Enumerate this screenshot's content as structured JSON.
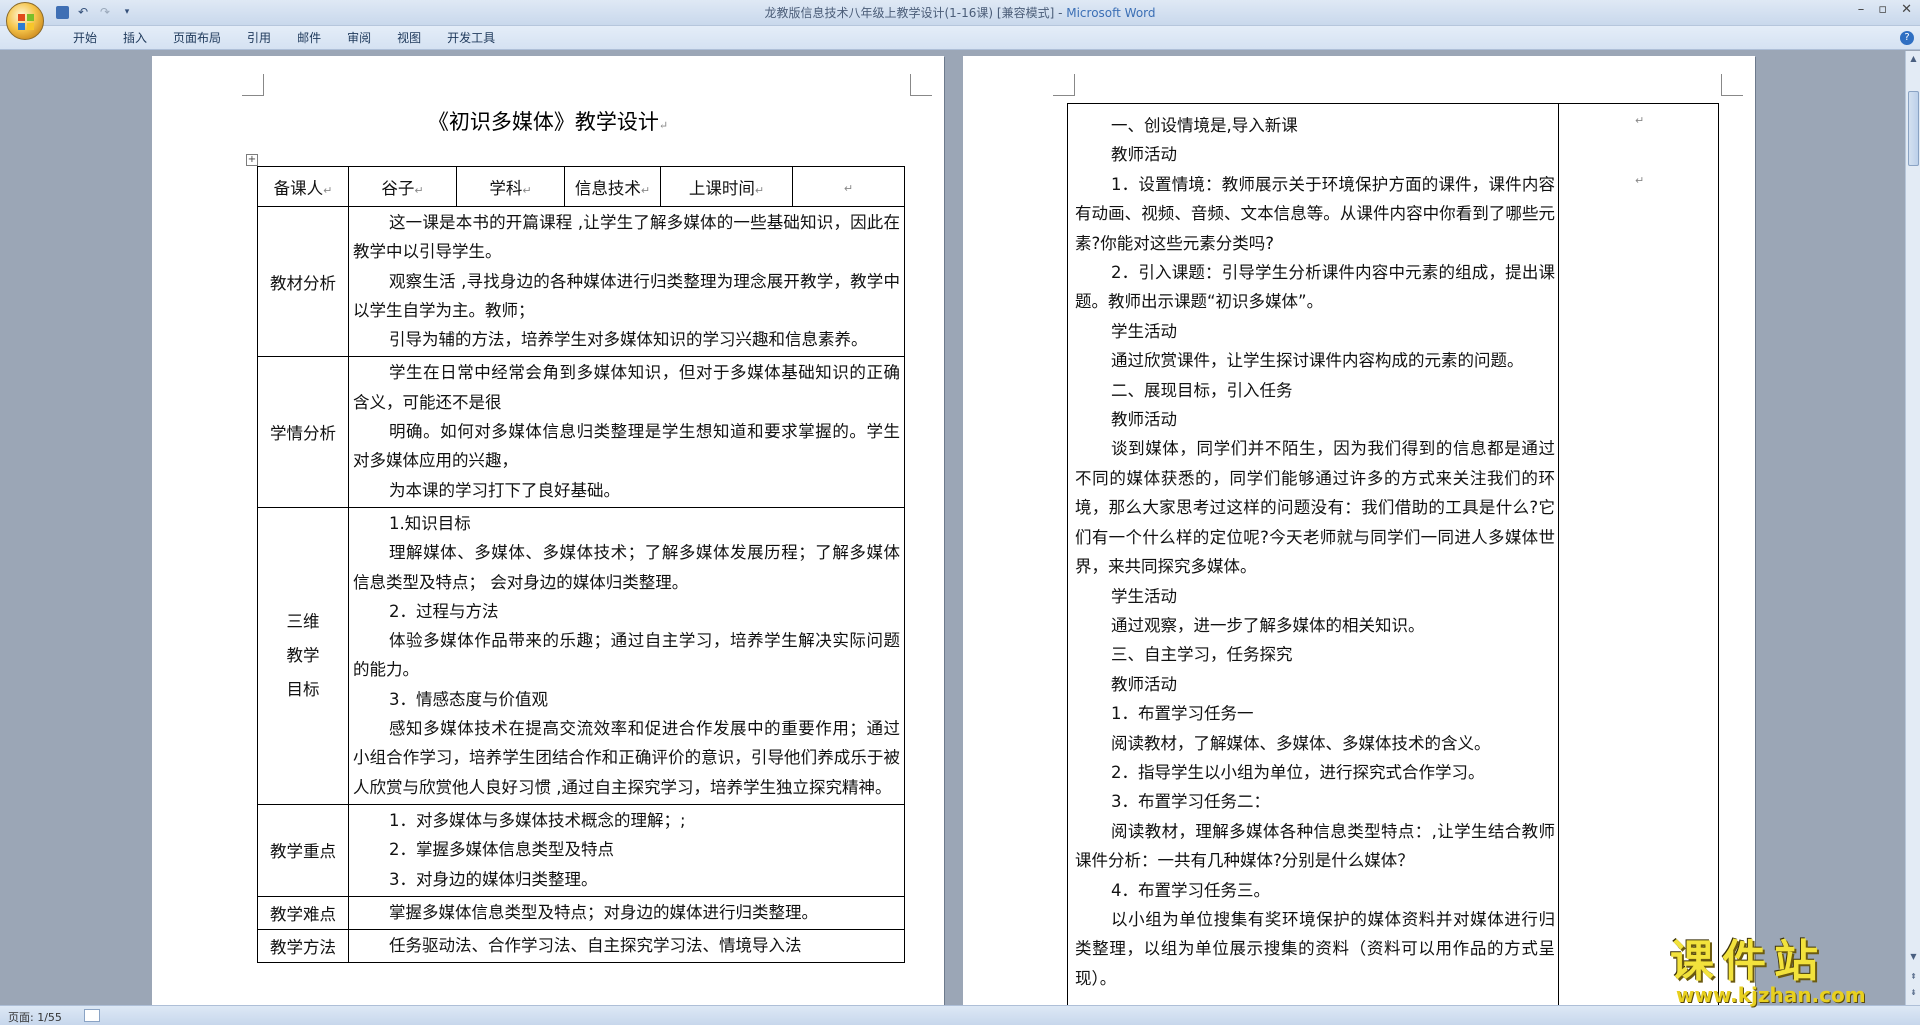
{
  "window": {
    "title": "龙教版信息技术八年级上教学设计(1-16课) [兼容模式] - ",
    "app_name": "Microsoft Word"
  },
  "ribbon": {
    "tabs": [
      "开始",
      "插入",
      "页面布局",
      "引用",
      "邮件",
      "审阅",
      "视图",
      "开发工具"
    ]
  },
  "status": {
    "page": "页面: 1/55"
  },
  "page1": {
    "title": "《初识多媒体》教学设计",
    "header": {
      "preparer_label": "备课人",
      "preparer": "谷子",
      "subject_label": "学科",
      "subject": "信息技术",
      "time_label": "上课时间",
      "time": ""
    },
    "rows": [
      {
        "label": "教材分析",
        "paras": [
          "这一课是本书的开篇课程 ,让学生了解多媒体的一些基础知识，因此在教学中以引导学生。",
          "观察生活 ,寻找身边的各种媒体进行归类整理为理念展开教学，教学中以学生自学为主。教师；",
          "引导为辅的方法，培养学生对多媒体知识的学习兴趣和信息素养。"
        ]
      },
      {
        "label": "学情分析",
        "paras": [
          "学生在日常中经常会角到多媒体知识，但对于多媒体基础知识的正确含义，可能还不是很",
          "明确。如何对多媒体信息归类整理是学生想知道和要求掌握的。学生对多媒体应用的兴趣，",
          "为本课的学习打下了良好基础。"
        ]
      },
      {
        "label_lines": [
          "三维",
          "教学",
          "目标"
        ],
        "paras": [
          "1.知识目标",
          "理解媒体、多媒体、多媒体技术；了解多媒体发展历程；了解多媒体信息类型及特点； 会对身边的媒体归类整理。",
          " 2．过程与方法",
          "体验多媒体作品带来的乐趣；通过自主学习，培养学生解决实际问题的能力。",
          "3．情感态度与价值观",
          "感知多媒体技术在提高交流效率和促进合作发展中的重要作用；通过小组合作学习，培养学生团结合作和正确评价的意识，引导他们养成乐于被人欣赏与欣赏他人良好习惯 ,通过自主探究学习，培养学生独立探究精神。"
        ]
      },
      {
        "label": "教学重点",
        "paras": [
          "1．对多媒体与多媒体技术概念的理解；;",
          "2．掌握多媒体信息类型及特点",
          "3．对身边的媒体归类整理。"
        ]
      },
      {
        "label": "教学难点",
        "paras": [
          "掌握多媒体信息类型及特点；对身边的媒体进行归类整理。"
        ]
      },
      {
        "label": "教学方法",
        "paras": [
          "任务驱动法、合作学习法、自主探究学习法、情境导入法"
        ]
      }
    ]
  },
  "page2": {
    "paras": [
      "一、创设情境是,导入新课",
      "教师活动",
      "1．设置情境：教师展示关于环境保护方面的课件，课件内容有动画、视频、音频、文本信息等。从课件内容中你看到了哪些元素?你能对这些元素分类吗?",
      "2．引入课题：引导学生分析课件内容中元素的组成，提出课题。教师出示课题“初识多媒体”。",
      "学生活动 ",
      "通过欣赏课件，让学生探讨课件内容构成的元素的问题。",
      "二、展现目标，引入任务",
      "教师活动",
      "谈到媒体，同学们并不陌生，因为我们得到的信息都是通过不同的媒体获悉的，同学们能够通过许多的方式来关注我们的环境，那么大家思考过这样的问题没有：我们借助的工具是什么?它们有一个什么样的定位呢?今天老师就与同学们一同进人多媒体世界，来共同探究多媒体。",
      "学生活动",
      "通过观察，进一步了解多媒体的相关知识。",
      "三、自主学习，任务探究",
      "教师活动 ",
      "1．布置学习任务一",
      "阅读教材，了解媒体、多媒体、多媒体技术的含义。",
      "2．指导学生以小组为单位，进行探究式合作学习。",
      "3．布置学习任务二：",
      "阅读教材，理解多媒体各种信息类型特点：,让学生结合教师课件分析：一共有几种媒体?分别是什么媒体？",
      "4．布置学习任务三。",
      " 以小组为单位搜集有奖环境保护的媒体资料并对媒体进行归类整理，以组为单位展示搜集的资料（资料可以用作品的方式呈现）。"
    ]
  },
  "watermark": {
    "brand": "课件站",
    "url": "www.kjzhan.com"
  },
  "colors": {
    "workspace": "#9ba6b6",
    "ribbon": "#d5e2f2",
    "app_name": "#3b6fb5"
  }
}
